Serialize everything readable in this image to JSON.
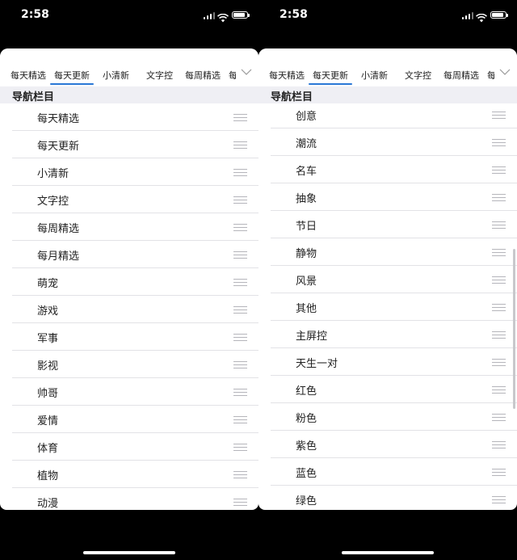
{
  "left": {
    "status": {
      "time": "2:58"
    },
    "tabs": [
      "每天精选",
      "每天更新",
      "小清新",
      "文字控",
      "每周精选",
      "每"
    ],
    "active_tab": "每天更新",
    "section_header": "导航栏目",
    "items": [
      "每天精选",
      "每天更新",
      "小清新",
      "文字控",
      "每周精选",
      "每月精选",
      "萌宠",
      "游戏",
      "军事",
      "影视",
      "帅哥",
      "爱情",
      "体育",
      "植物",
      "动漫"
    ]
  },
  "right": {
    "status": {
      "time": "2:58"
    },
    "tabs": [
      "每天精选",
      "每天更新",
      "小清新",
      "文字控",
      "每周精选",
      "每"
    ],
    "active_tab": "每天更新",
    "section_header": "导航栏目",
    "items": [
      "创意",
      "潮流",
      "名车",
      "抽象",
      "节日",
      "静物",
      "风景",
      "其他",
      "主屏控",
      "天生一对",
      "红色",
      "粉色",
      "紫色",
      "蓝色",
      "绿色"
    ]
  },
  "icons": {
    "dropdown": "chevron-down-icon",
    "reorder": "reorder-handle-icon"
  },
  "colors": {
    "accent": "#2a78d6",
    "header_bg": "#efeff4"
  }
}
